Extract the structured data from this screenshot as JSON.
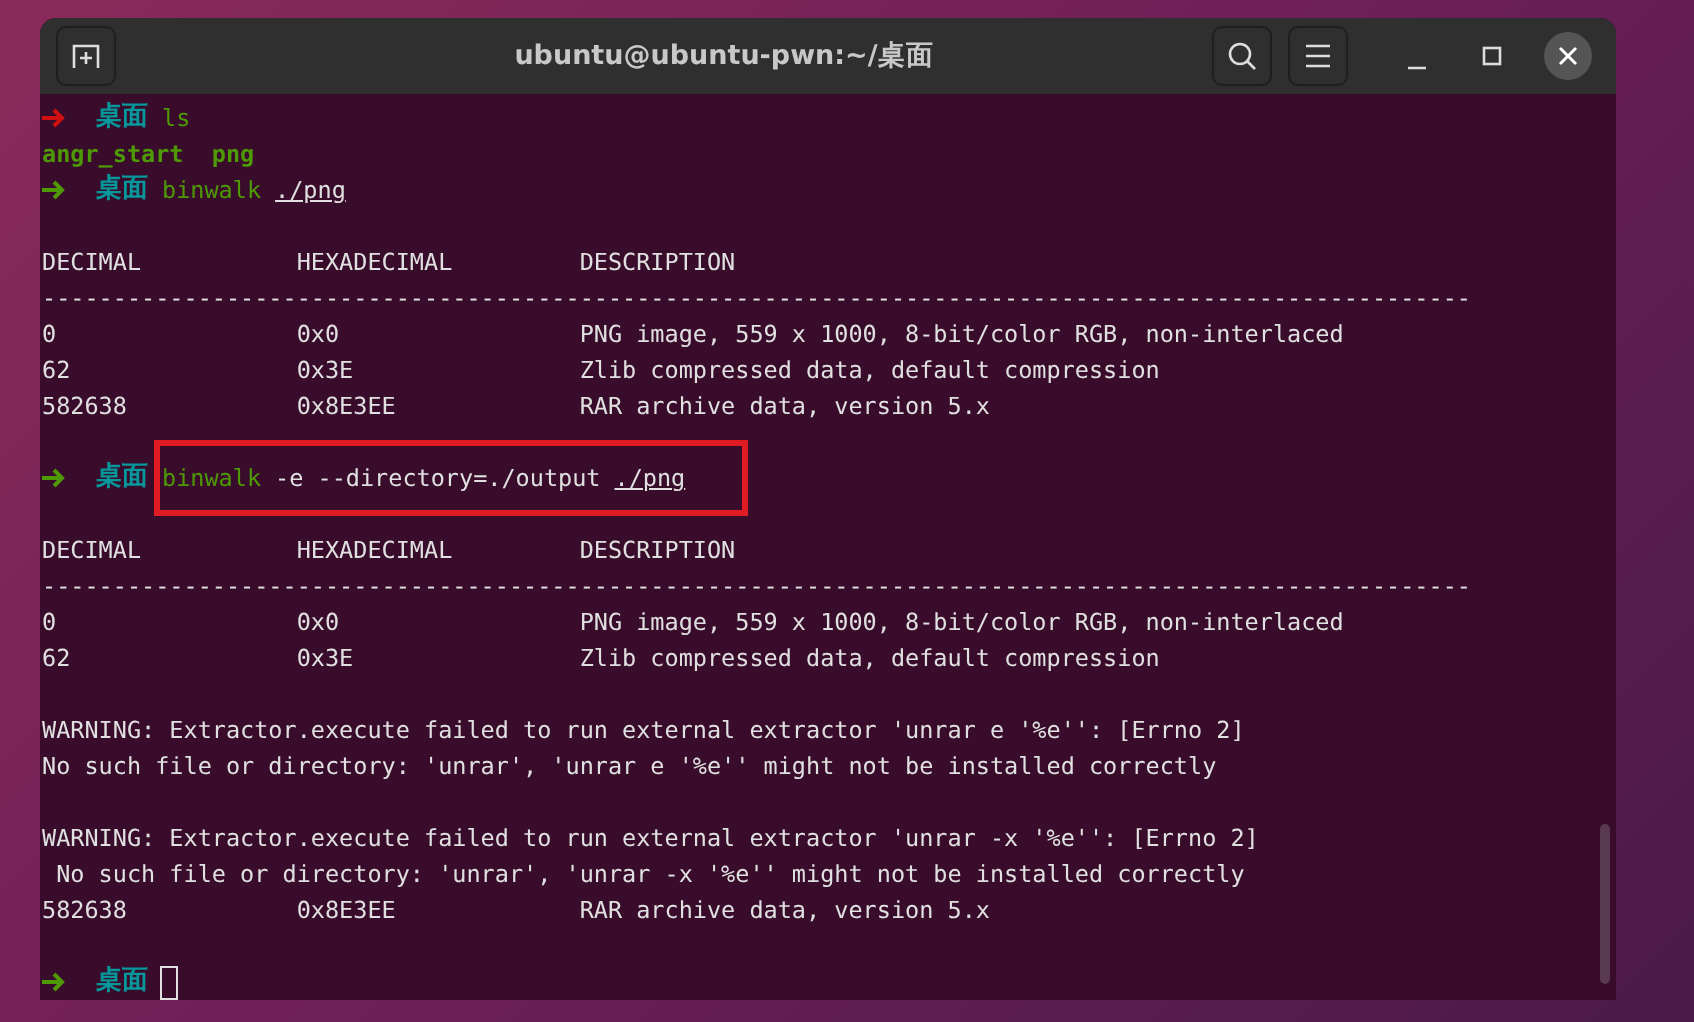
{
  "window": {
    "title": "ubuntu@ubuntu-pwn:~/桌面"
  },
  "lines": [
    {
      "kind": "prompt",
      "color": "#d01010",
      "directory": "桌面",
      "command": [
        {
          "kind": "program",
          "text": "ls"
        }
      ],
      "highlighted": false
    },
    {
      "kind": "listing",
      "text": "angr_start  png"
    },
    {
      "kind": "prompt",
      "color": "#4e9a06",
      "directory": "桌面",
      "command": [
        {
          "kind": "program",
          "text": "binwalk"
        },
        {
          "kind": "path",
          "text": "./png"
        }
      ],
      "highlighted": false
    },
    {
      "kind": "blank"
    },
    {
      "kind": "output",
      "text": "DECIMAL           HEXADECIMAL         DESCRIPTION"
    },
    {
      "kind": "output",
      "text": "-----------------------------------------------------------------------------------------------------"
    },
    {
      "kind": "output",
      "text": "0                 0x0                 PNG image, 559 x 1000, 8-bit/color RGB, non-interlaced"
    },
    {
      "kind": "output",
      "text": "62                0x3E                Zlib compressed data, default compression"
    },
    {
      "kind": "output",
      "text": "582638            0x8E3EE             RAR archive data, version 5.x"
    },
    {
      "kind": "blank"
    },
    {
      "kind": "prompt",
      "color": "#4e9a06",
      "directory": "桌面",
      "command": [
        {
          "kind": "program",
          "text": "binwalk"
        },
        {
          "kind": "argument",
          "text": "-e --directory=./output"
        },
        {
          "kind": "path",
          "text": "./png"
        }
      ],
      "highlighted": true
    },
    {
      "kind": "blank"
    },
    {
      "kind": "output",
      "text": "DECIMAL           HEXADECIMAL         DESCRIPTION"
    },
    {
      "kind": "output",
      "text": "-----------------------------------------------------------------------------------------------------"
    },
    {
      "kind": "output",
      "text": "0                 0x0                 PNG image, 559 x 1000, 8-bit/color RGB, non-interlaced"
    },
    {
      "kind": "output",
      "text": "62                0x3E                Zlib compressed data, default compression"
    },
    {
      "kind": "blank"
    },
    {
      "kind": "output",
      "text": "WARNING: Extractor.execute failed to run external extractor 'unrar e '%e'': [Errno 2]"
    },
    {
      "kind": "output",
      "text": "No such file or directory: 'unrar', 'unrar e '%e'' might not be installed correctly"
    },
    {
      "kind": "blank"
    },
    {
      "kind": "output",
      "text": "WARNING: Extractor.execute failed to run external extractor 'unrar -x '%e'': [Errno 2]"
    },
    {
      "kind": "output",
      "text": " No such file or directory: 'unrar', 'unrar -x '%e'' might not be installed correctly"
    },
    {
      "kind": "output",
      "text": "582638            0x8E3EE             RAR archive data, version 5.x"
    },
    {
      "kind": "blank"
    },
    {
      "kind": "prompt",
      "color": "#4e9a06",
      "directory": "桌面",
      "highlighted": false,
      "cursor": true
    }
  ]
}
